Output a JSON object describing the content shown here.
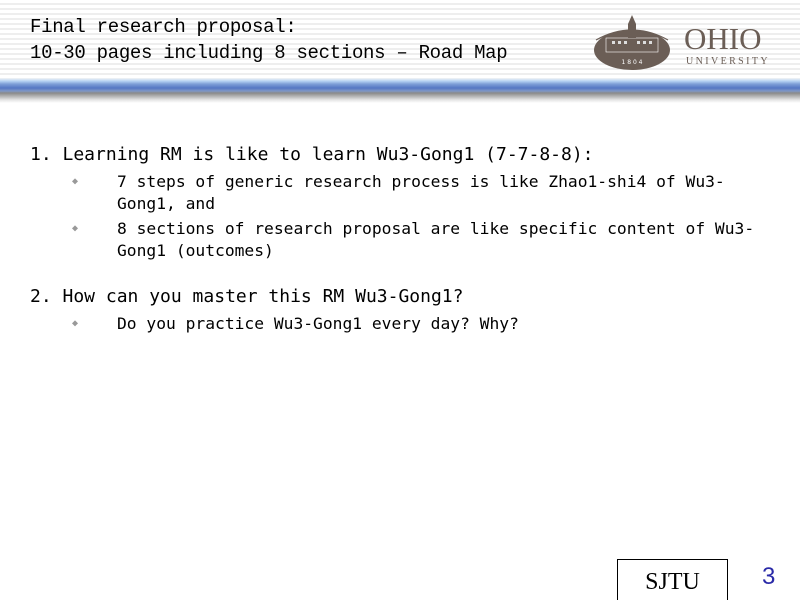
{
  "header": {
    "title_line1": "Final research proposal:",
    "title_line2": "10-30 pages including 8 sections –  Road Map",
    "logo": {
      "name": "OHIO",
      "sub": "UNIVERSITY",
      "year": "1 8 0 4",
      "color": "#6b5e56"
    }
  },
  "content": {
    "items": [
      {
        "label": "1. Learning RM is like to learn Wu3-Gong1 (7-7-8-8):",
        "bullets": [
          "7 steps of generic research process is like Zhao1-shi4 of Wu3-Gong1, and",
          "8 sections of research proposal are like specific content of Wu3-Gong1 (outcomes)"
        ]
      },
      {
        "label": "2. How can you master this RM Wu3-Gong1?",
        "bullets": [
          "Do you practice Wu3-Gong1 every day? Why?"
        ]
      }
    ]
  },
  "footer": {
    "box_label": "SJTU",
    "page_number": "3",
    "page_number_color": "#2a2aa8"
  }
}
